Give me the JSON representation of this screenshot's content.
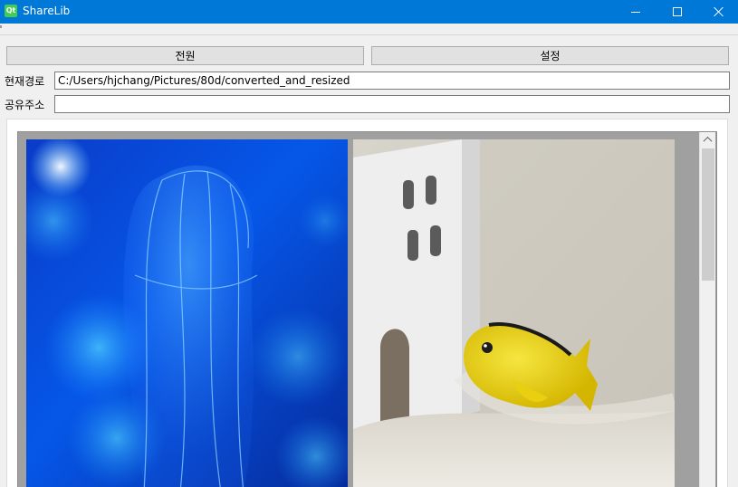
{
  "window": {
    "title": "ShareLib",
    "app_icon_text": "Qt"
  },
  "toolbar": {
    "power_label": "전원",
    "settings_label": "설정"
  },
  "form": {
    "path_label": "현재경로",
    "path_value": "C:/Users/hjchang/Pictures/80d/converted_and_resized",
    "share_label": "공유주소",
    "share_value": ""
  },
  "gallery": {
    "items": [
      {
        "icon": "jellyfish-photo"
      },
      {
        "icon": "yellow-fish-photo"
      }
    ]
  },
  "colors": {
    "titlebar": "#0078d7",
    "button_bg": "#e1e1e1",
    "gallery_bg": "#a0a0a0"
  }
}
